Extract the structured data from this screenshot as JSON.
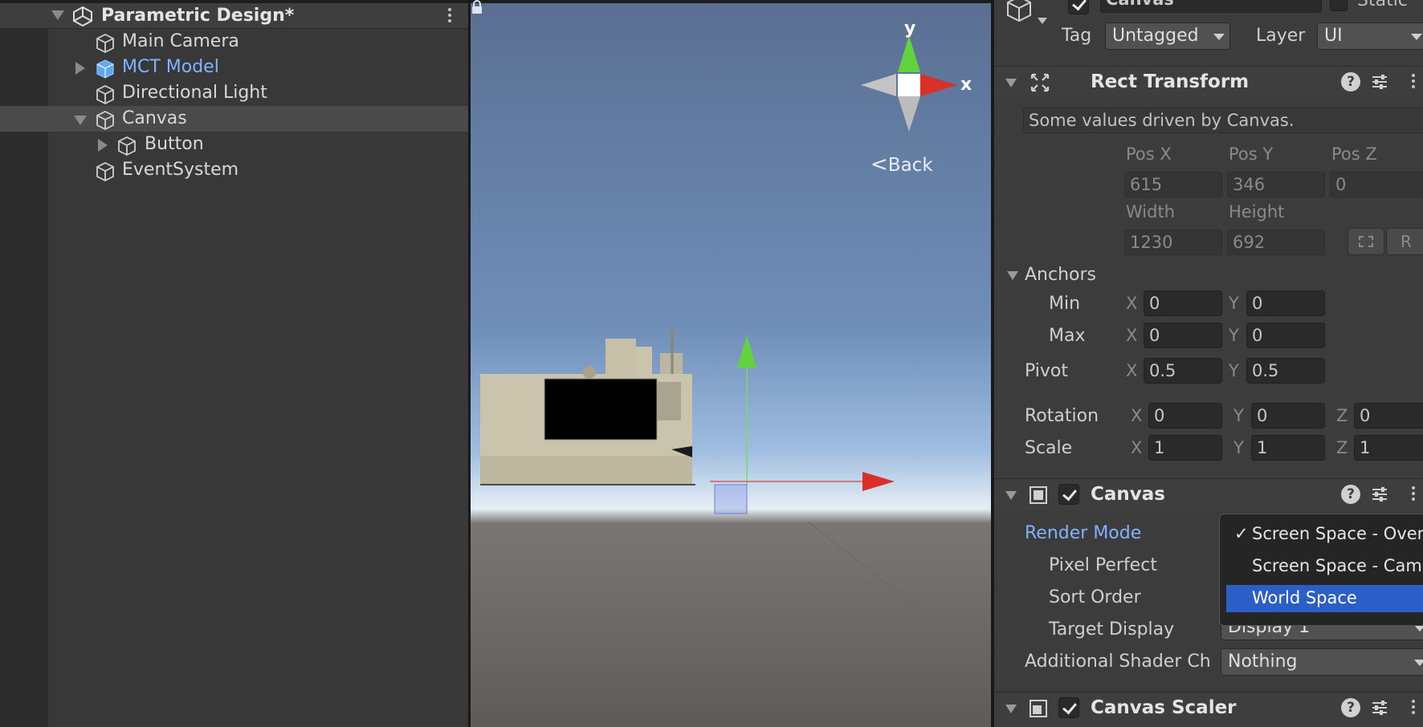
{
  "hierarchy": {
    "scene_title": "Parametric Design*",
    "items": [
      {
        "label": "Main Camera"
      },
      {
        "label": "MCT Model"
      },
      {
        "label": "Directional Light"
      },
      {
        "label": "Canvas"
      },
      {
        "label": "Button"
      },
      {
        "label": "EventSystem"
      }
    ]
  },
  "scene": {
    "gizmo_y": "y",
    "gizmo_x": "x",
    "back_label": "Back"
  },
  "inspector": {
    "object_name": "Canvas",
    "static_label": "Static",
    "tag_label": "Tag",
    "tag_value": "Untagged",
    "layer_label": "Layer",
    "layer_value": "UI",
    "rect_transform": {
      "title": "Rect Transform",
      "note": "Some values driven by Canvas.",
      "pos_x_label": "Pos X",
      "pos_y_label": "Pos Y",
      "pos_z_label": "Pos Z",
      "pos_x": "615",
      "pos_y": "346",
      "pos_z": "0",
      "width_label": "Width",
      "height_label": "Height",
      "width": "1230",
      "height": "692",
      "r_button": "R",
      "anchors_label": "Anchors",
      "min_label": "Min",
      "max_label": "Max",
      "anchor_min_x": "0",
      "anchor_min_y": "0",
      "anchor_max_x": "0",
      "anchor_max_y": "0",
      "pivot_label": "Pivot",
      "pivot_x": "0.5",
      "pivot_y": "0.5",
      "rotation_label": "Rotation",
      "rot_x": "0",
      "rot_y": "0",
      "rot_z": "0",
      "scale_label": "Scale",
      "scale_x": "1",
      "scale_y": "1",
      "scale_z": "1",
      "axis_x": "X",
      "axis_y": "Y",
      "axis_z": "Z"
    },
    "canvas": {
      "title": "Canvas",
      "render_mode_label": "Render Mode",
      "pixel_perfect_label": "Pixel Perfect",
      "sort_order_label": "Sort Order",
      "target_display_label": "Target Display",
      "target_display_value": "Display 1",
      "additional_shader_label": "Additional Shader Ch",
      "additional_shader_value": "Nothing"
    },
    "render_mode_menu": {
      "options": [
        "Screen Space - Overlay",
        "Screen Space - Camera",
        "World Space"
      ],
      "checked_index": 0,
      "highlighted_index": 2
    },
    "canvas_scaler": {
      "title": "Canvas Scaler"
    }
  },
  "colors": {
    "accent_selection": "#2b5fc7",
    "prefab_text": "#7fb3ff",
    "render_mode_label": "#7fb3ff",
    "gizmo_x": "#d9302a",
    "gizmo_y": "#62d23e"
  }
}
